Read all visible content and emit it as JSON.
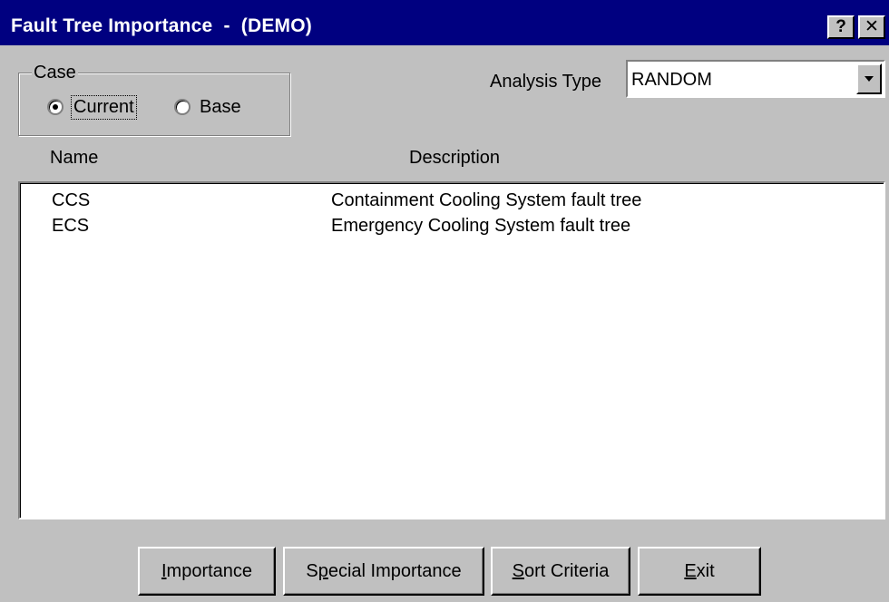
{
  "window": {
    "title": "Fault Tree Importance  -  (DEMO)",
    "help_button": "?",
    "close_button": "✕"
  },
  "case": {
    "legend": "Case",
    "options": [
      {
        "label": "Current",
        "selected": true
      },
      {
        "label": "Base",
        "selected": false
      }
    ]
  },
  "analysis": {
    "label": "Analysis Type",
    "value": "RANDOM"
  },
  "list": {
    "columns": [
      "Name",
      "Description"
    ],
    "rows": [
      {
        "name": "CCS",
        "description": "Containment Cooling System fault tree"
      },
      {
        "name": "ECS",
        "description": "Emergency Cooling System fault tree"
      }
    ]
  },
  "buttons": {
    "importance": {
      "mnemonic": "I",
      "rest": "mportance"
    },
    "special_importance": {
      "pre": "S",
      "mnemonic": "p",
      "rest": "ecial Importance"
    },
    "sort_criteria": {
      "mnemonic": "S",
      "rest": "ort Criteria"
    },
    "exit": {
      "mnemonic": "E",
      "rest": "xit"
    }
  },
  "colors": {
    "titlebar": "#000080",
    "face": "#c0c0c0",
    "list_bg": "#ffffff"
  }
}
